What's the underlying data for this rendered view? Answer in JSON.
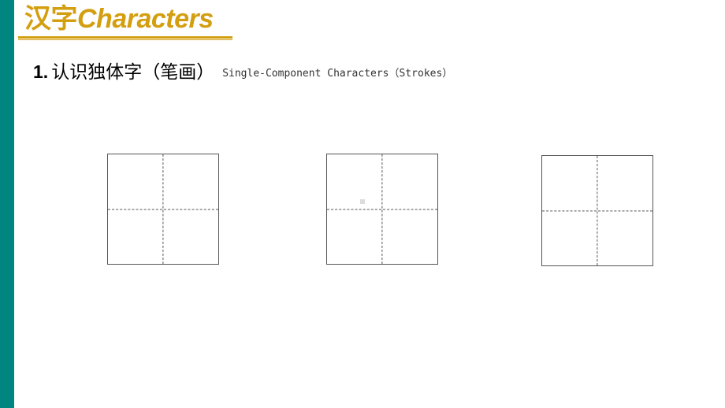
{
  "slide": {
    "accent_bar_color": "#008580",
    "title": {
      "zh": "汉字",
      "en": "Characters",
      "color": "#d39e0f"
    },
    "section": {
      "number": "1.",
      "zh": "认识独体字（笔画）",
      "en": "Single-Component Characters（Strokes）"
    },
    "practice_grids": [
      {
        "id": "grid-1",
        "character": ""
      },
      {
        "id": "grid-2",
        "character": ""
      },
      {
        "id": "grid-3",
        "character": ""
      }
    ]
  }
}
